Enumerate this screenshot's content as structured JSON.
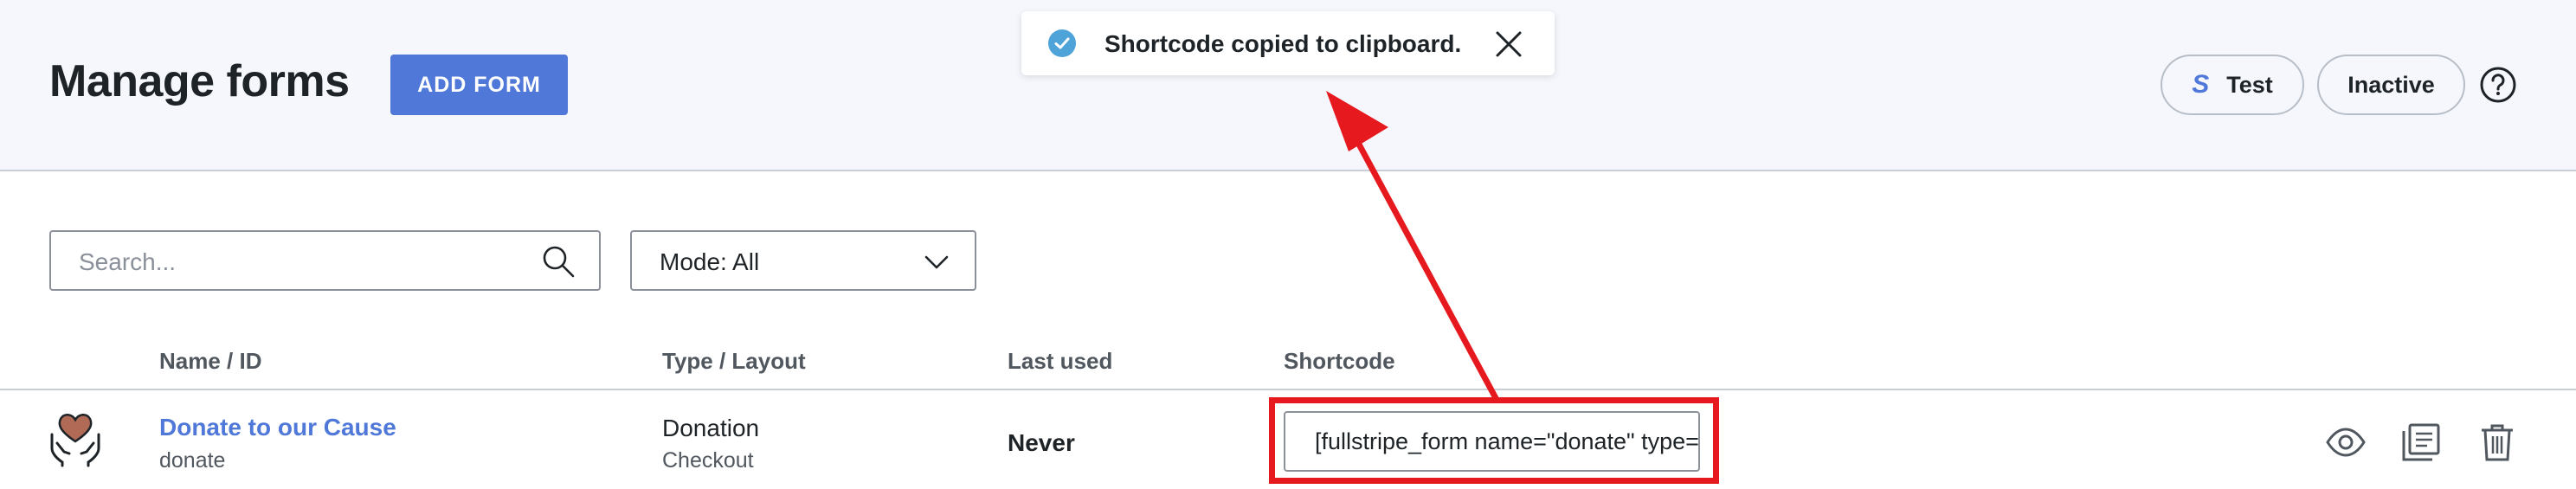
{
  "header": {
    "title": "Manage forms",
    "add_form_label": "ADD FORM",
    "test_label": "Test",
    "stripe_letter": "S",
    "inactive_label": "Inactive",
    "help_icon": "help-icon"
  },
  "toast": {
    "message": "Shortcode copied to clipboard.",
    "check_icon": "check-circle-icon",
    "close_icon": "close-icon"
  },
  "filters": {
    "search_placeholder": "Search...",
    "search_value": "",
    "mode_label": "Mode: All"
  },
  "table": {
    "columns": [
      "Name / ID",
      "Type / Layout",
      "Last used",
      "Shortcode"
    ],
    "rows": [
      {
        "name": "Donate to our Cause",
        "id": "donate",
        "type": "Donation",
        "layout": "Checkout",
        "last_used": "Never",
        "shortcode": "[fullstripe_form name=\"donate\" type=\"inline_donation\"]"
      }
    ]
  },
  "colors": {
    "accent": "#4f78d9",
    "annotation": "#e6191e",
    "header_bg": "#f5f7fd"
  }
}
